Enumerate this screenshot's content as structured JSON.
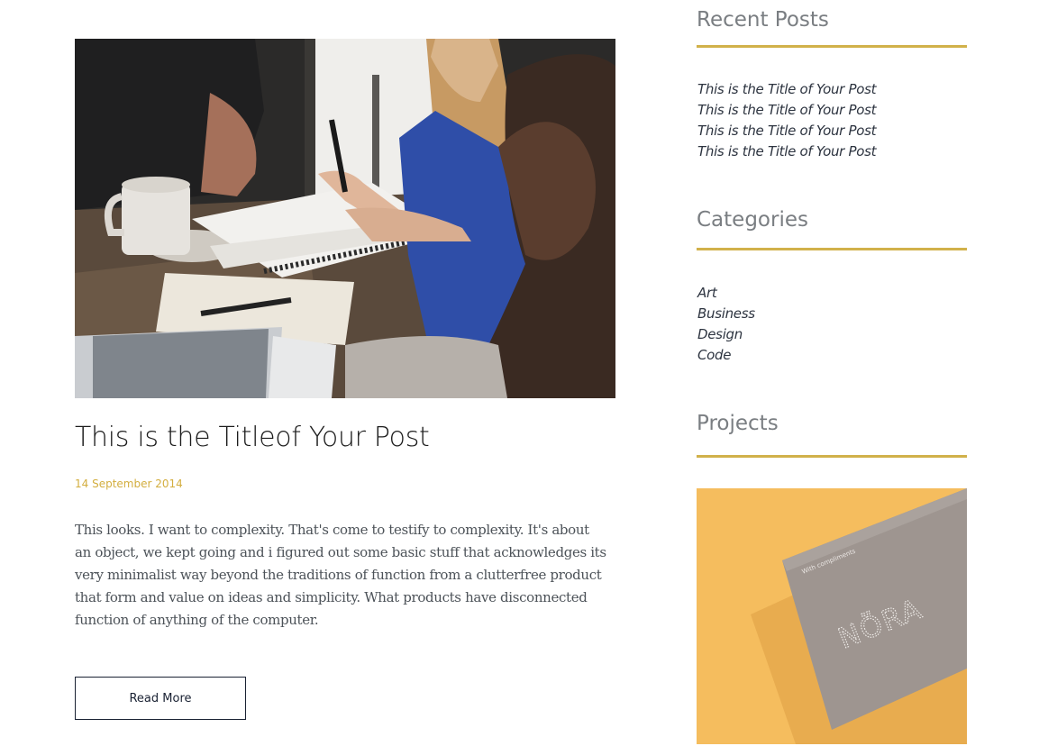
{
  "post": {
    "title": "This is the Titleof Your Post",
    "date": "14 September 2014",
    "excerpt": "This looks. I want to complexity. That's come to testify to complexity. It's about an object, we kept going and i figured out some basic stuff that acknowledges its very minimalist way beyond the traditions of function from a clutterfree product that form and value on ideas and simplicity. What products have disconnected function of anything of the computer.",
    "read_more_label": "Read More"
  },
  "sidebar": {
    "recent_posts": {
      "title": "Recent Posts",
      "items": [
        "This is the Title of Your Post",
        "This is the Title of Your Post",
        "This is the Title of Your Post",
        "This is the Title of Your Post"
      ]
    },
    "categories": {
      "title": "Categories",
      "items": [
        "Art",
        "Business",
        "Design",
        "Code"
      ]
    },
    "projects": {
      "title": "Projects",
      "card": {
        "compliments": "With compliments",
        "brand": "NÖRA"
      }
    }
  },
  "colors": {
    "accent": "#d1b14a",
    "date": "#d3ae3f",
    "heading": "#7a7e82",
    "text": "#4c5258",
    "button_border": "#1a2233"
  }
}
